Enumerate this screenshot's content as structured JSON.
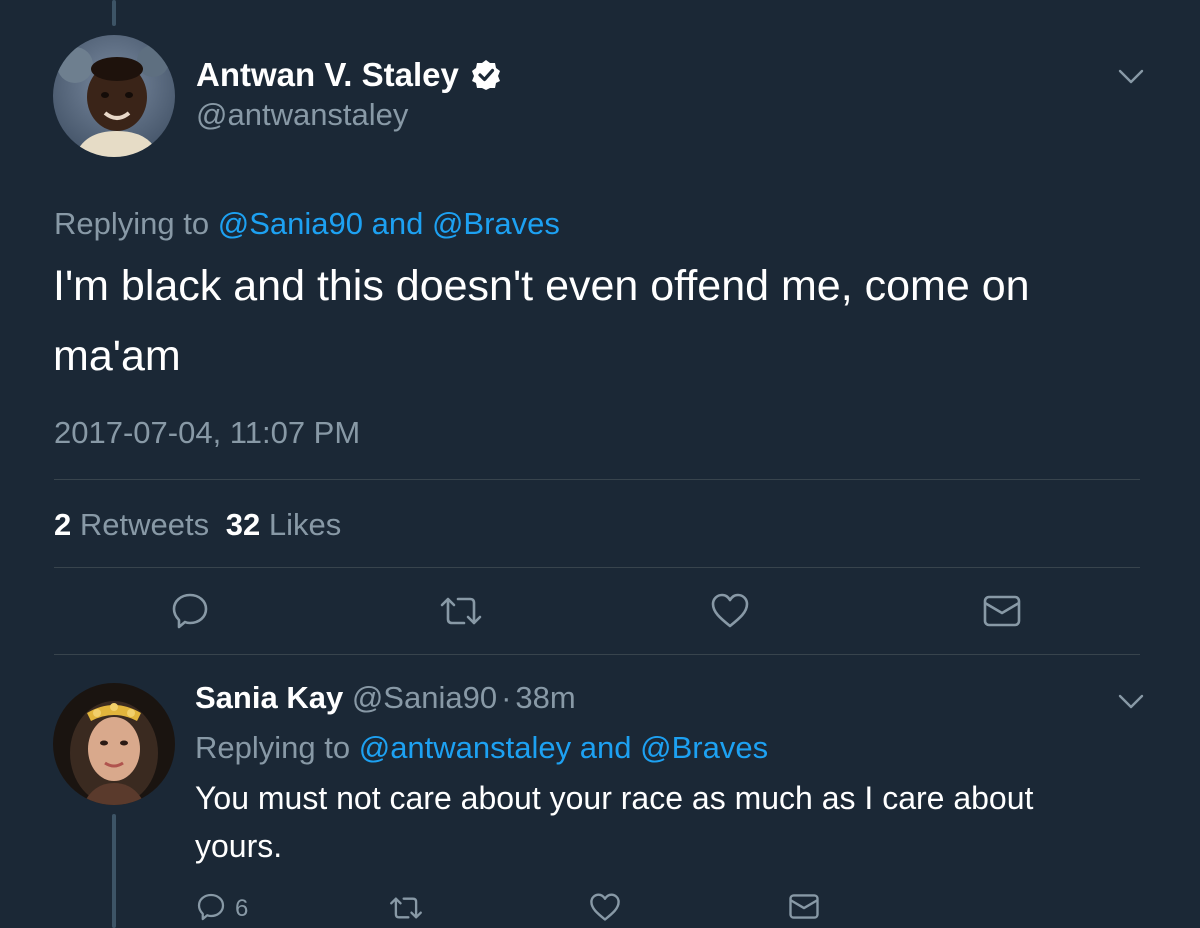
{
  "colors": {
    "background": "#1b2836",
    "text": "#ffffff",
    "secondary": "#8899a6",
    "link": "#1da1f2",
    "divider": "#38444d",
    "thread_line": "#3d5466"
  },
  "main_tweet": {
    "author_name": "Antwan V. Staley",
    "author_handle": "@antwanstaley",
    "verified": true,
    "replying_prefix": "Replying to",
    "replying_to_1": "@Sania90",
    "replying_and": "and",
    "replying_to_2": "@Braves",
    "text_line1": "I'm black and this doesn't even offend me, come on",
    "text_line2": "ma'am",
    "timestamp": "2017-07-04, 11:07 PM",
    "retweet_count": "2",
    "retweet_label": "Retweets",
    "like_count": "32",
    "like_label": "Likes",
    "actions": [
      "reply-icon",
      "retweet-icon",
      "like-icon",
      "message-icon"
    ]
  },
  "reply_tweet": {
    "author_name": "Sania Kay",
    "author_handle": "@Sania90",
    "separator": "·",
    "time_ago": "38m",
    "replying_prefix": "Replying to",
    "replying_to_1": "@antwanstaley",
    "replying_and": "and",
    "replying_to_2": "@Braves",
    "text_line1": "You must not care about your race as much as I care about",
    "text_line2": "yours.",
    "reply_count": "6",
    "actions": [
      "reply-icon",
      "retweet-icon",
      "like-icon",
      "message-icon"
    ]
  }
}
